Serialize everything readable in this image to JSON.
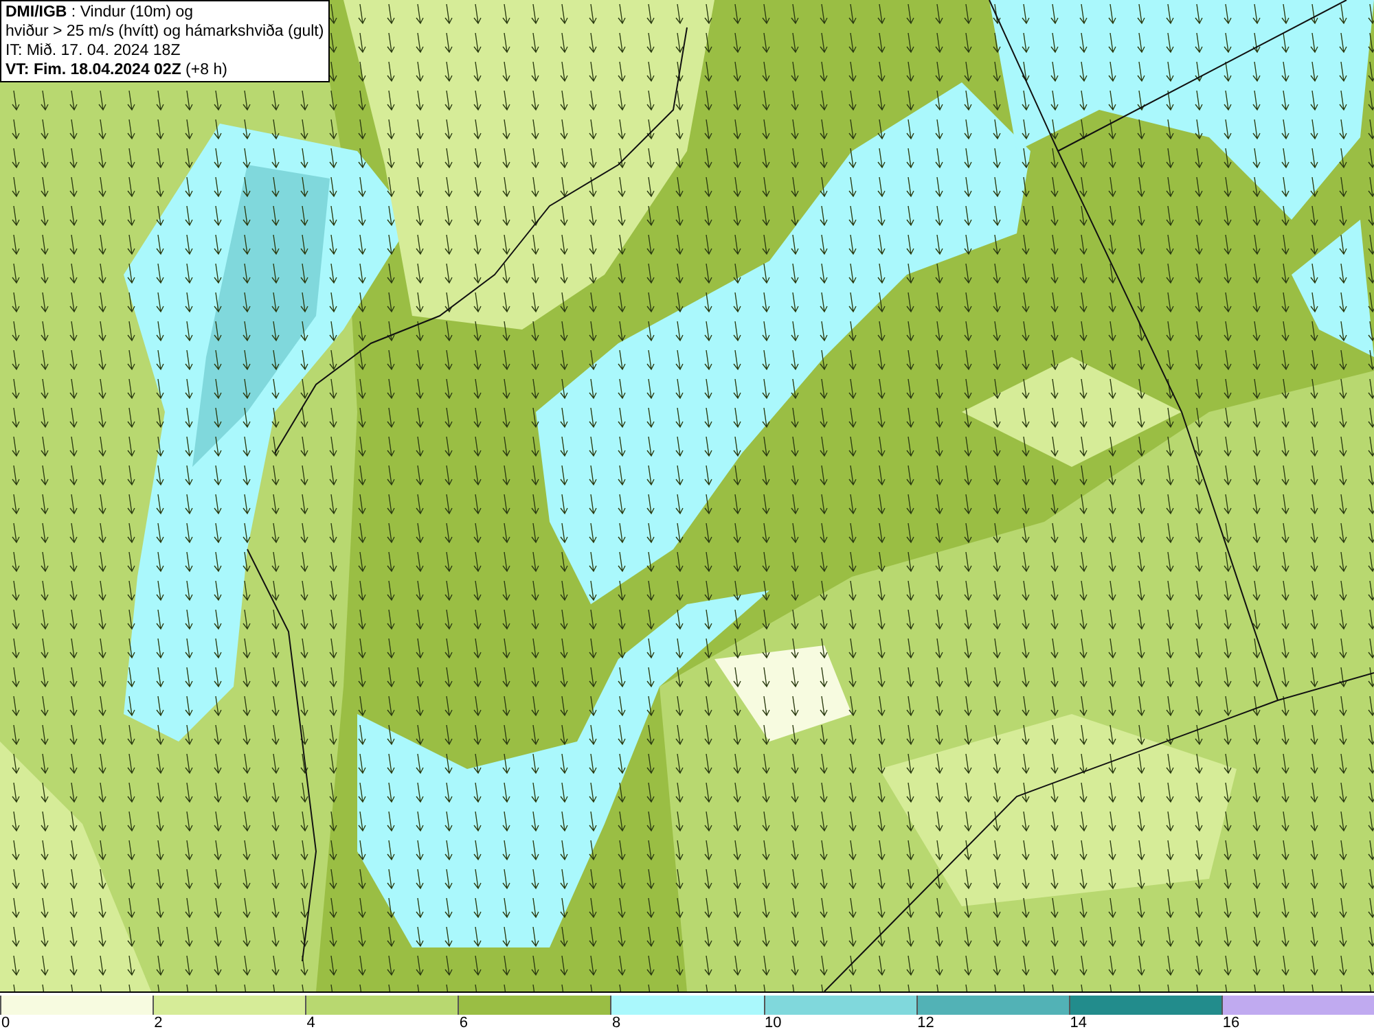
{
  "header": {
    "lines": [
      "**DMI/IGB** : Vindur (10m) og",
      "hviður > 25 m/s (hvítt) og hámarkshviða (gult)",
      "IT: Mið. 17. 04. 2024 18Z",
      "**VT: Fim. 18.04.2024 02Z** (+8 h)"
    ]
  },
  "legend": {
    "bins": [
      {
        "color": "#f7fbe0",
        "label": "0"
      },
      {
        "color": "#d6ec98",
        "label": "2"
      },
      {
        "color": "#b8d870",
        "label": "4"
      },
      {
        "color": "#9abe44",
        "label": "6"
      },
      {
        "color": "#aaf8fc",
        "label": "8"
      },
      {
        "color": "#80d8dc",
        "label": "10"
      },
      {
        "color": "#52b2b6",
        "label": "12"
      },
      {
        "color": "#228c8c",
        "label": "14"
      },
      {
        "color": "#c0aaf0",
        "label": "16"
      }
    ]
  }
}
